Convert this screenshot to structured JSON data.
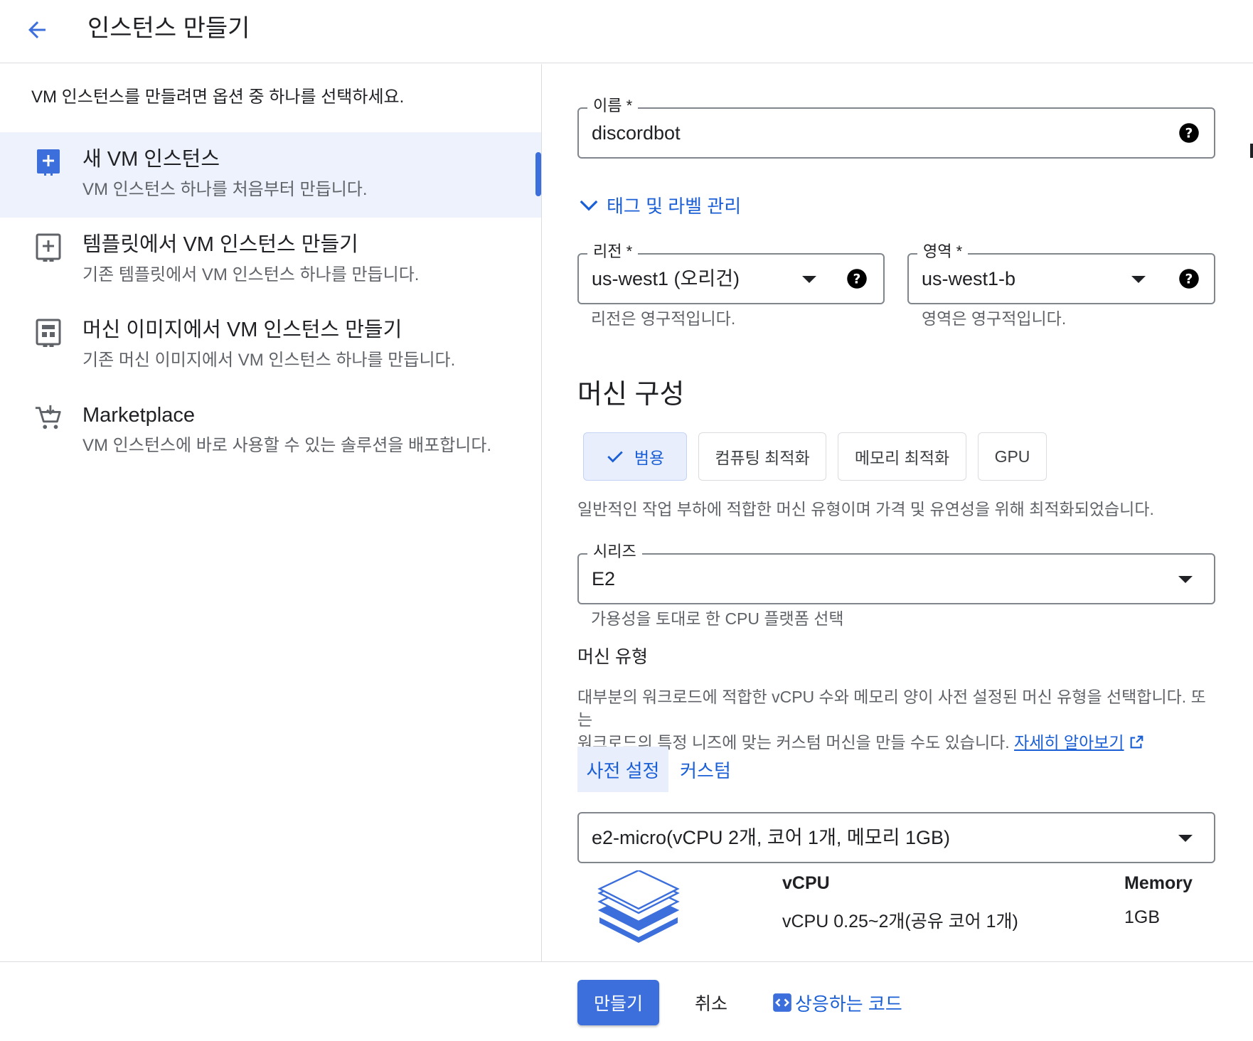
{
  "header": {
    "title": "인스턴스 만들기"
  },
  "left": {
    "intro": "VM 인스턴스를 만들려면 옵션 중 하나를 선택하세요.",
    "options": [
      {
        "title": "새 VM 인스턴스",
        "desc": "VM 인스턴스 하나를 처음부터 만듭니다.",
        "icon": "add-box-icon",
        "selected": true
      },
      {
        "title": "템플릿에서 VM 인스턴스 만들기",
        "desc": "기존 템플릿에서 VM 인스턴스 하나를 만듭니다.",
        "icon": "template-icon",
        "selected": false
      },
      {
        "title": "머신 이미지에서 VM 인스턴스 만들기",
        "desc": "기존 머신 이미지에서 VM 인스턴스 하나를 만듭니다.",
        "icon": "machine-image-icon",
        "selected": false
      },
      {
        "title": "Marketplace",
        "desc": "VM 인스턴스에 바로 사용할 수 있는 솔루션을 배포합니다.",
        "icon": "marketplace-cart-icon",
        "selected": false
      }
    ]
  },
  "form": {
    "name": {
      "label": "이름 *",
      "value": "discordbot"
    },
    "tags_toggle": "태그 및 라벨 관리",
    "region": {
      "label": "리전 *",
      "value": "us-west1 (오리건)",
      "helper": "리전은 영구적입니다."
    },
    "zone": {
      "label": "영역 *",
      "value": "us-west1-b",
      "helper": "영역은 영구적입니다."
    },
    "machine_config_title": "머신 구성",
    "families": [
      {
        "label": "범용",
        "active": true
      },
      {
        "label": "컴퓨팅 최적화",
        "active": false
      },
      {
        "label": "메모리 최적화",
        "active": false
      },
      {
        "label": "GPU",
        "active": false
      }
    ],
    "family_desc": "일반적인 작업 부하에 적합한 머신 유형이며 가격 및 유연성을 위해 최적화되었습니다.",
    "series": {
      "label": "시리즈",
      "value": "E2",
      "helper": "가용성을 토대로 한 CPU 플랫폼 선택"
    },
    "machine_type_title": "머신 유형",
    "machine_type_desc_1": "대부분의 워크로드에 적합한 vCPU 수와 메모리 양이 사전 설정된 머신 유형을 선택합니다. 또는",
    "machine_type_desc_2": "워크로드의 특정 니즈에 맞는 커스텀 머신을 만들 수도 있습니다.",
    "learn_more": "자세히 알아보기",
    "segments": [
      {
        "label": "사전 설정",
        "active": true
      },
      {
        "label": "커스텀",
        "active": false
      }
    ],
    "machine_type_value": "e2-micro(vCPU 2개, 코어 1개, 메모리 1GB)",
    "spec": {
      "vcpu_label": "vCPU",
      "vcpu_value": "vCPU 0.25~2개(공유 코어 1개)",
      "memory_label": "Memory",
      "memory_value": "1GB"
    }
  },
  "footer": {
    "create": "만들기",
    "cancel": "취소",
    "equivalent_code": "상응하는 코드"
  },
  "colors": {
    "accent": "#3c6fdb",
    "link": "#1a5fd6",
    "selected_bg": "#eef2fc"
  }
}
